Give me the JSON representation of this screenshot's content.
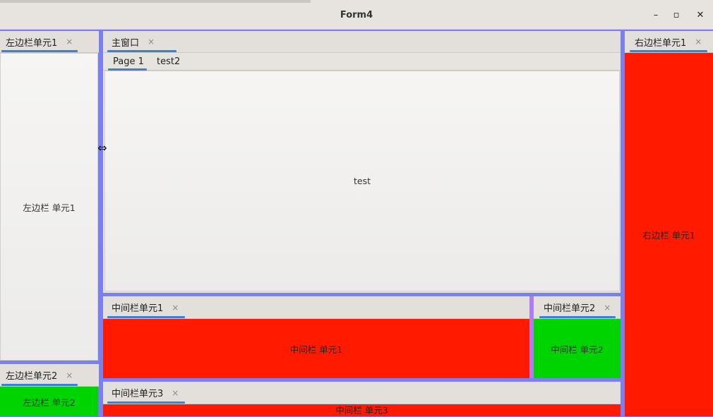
{
  "window": {
    "title": "Form4",
    "minimize_label": "–",
    "maximize_label": "▫",
    "close_label": "✕"
  },
  "left_panel_1": {
    "tab_label": "左边栏单元1",
    "content": "左边栏 单元1"
  },
  "left_panel_2": {
    "tab_label": "左边栏单元2",
    "content": "左边栏 单元2"
  },
  "main_window": {
    "tab_label": "主窗口",
    "inner_tabs": [
      "Page 1",
      "test2"
    ],
    "active_inner_tab": "Page 1",
    "content": "test"
  },
  "middle_panel_1": {
    "tab_label": "中间栏单元1",
    "content": "中间栏 单元1"
  },
  "middle_panel_2": {
    "tab_label": "中间栏单元2",
    "content": "中间栏 单元2"
  },
  "middle_panel_3": {
    "tab_label": "中间栏单元3",
    "content": "中间栏 单元3"
  },
  "right_panel_1": {
    "tab_label": "右边栏单元1",
    "content": "右边栏 单元1"
  },
  "tab_close_glyph": "×",
  "colors": {
    "accent": "#3f7fd8",
    "splitter": "#7c7ff0",
    "red_panel": "#ff1a00",
    "green_panel": "#00d400"
  },
  "icons": [
    "close-icon",
    "resize-cursor-icon"
  ]
}
